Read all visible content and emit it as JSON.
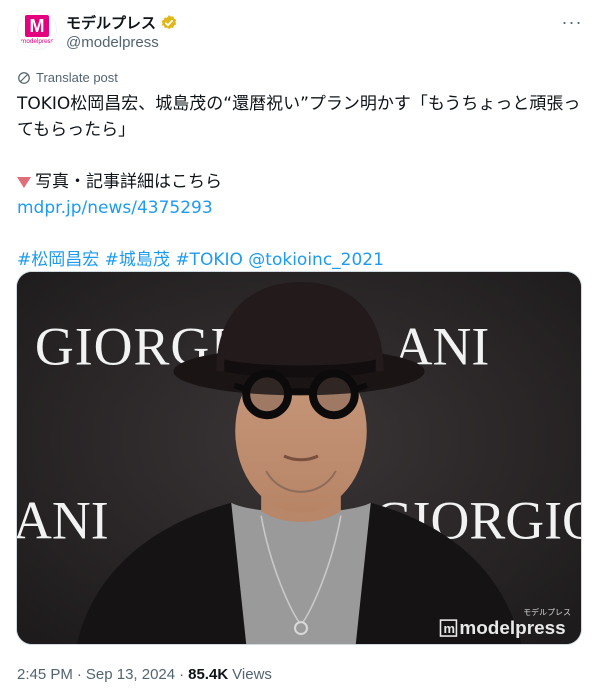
{
  "account": {
    "display_name": "モデルプレス",
    "handle": "@modelpress",
    "verified_badge_color": "#e2b719",
    "avatar_letter": "M",
    "avatar_sub": "modelpress",
    "brand_color": "#e4007f"
  },
  "more_icon": "more-horizontal-icon",
  "translate_label": "Translate post",
  "post": {
    "line1": "TOKIO松岡昌宏、城島茂の“還暦祝い”プラン明かす「もうちょっと頑張っ",
    "line2": "てもらったら」",
    "info_label": "写真・記事詳細はこちら",
    "link": "mdpr.jp/news/4375293",
    "hashtags": [
      "#松岡昌宏",
      "#城島茂",
      "#TOKIO",
      "@tokioinc_2021"
    ]
  },
  "media": {
    "backdrop_text_top": "GIORGIO",
    "backdrop_text_top_right": "ANI",
    "backdrop_text_bottom_left": "ANI",
    "backdrop_text_bottom_right": "GIORGIO",
    "watermark_small": "モデルプレス",
    "watermark_large": "modelpress"
  },
  "meta": {
    "time": "2:45 PM",
    "separator": "·",
    "date": "Sep 13, 2024",
    "views_count": "85.4K",
    "views_label": "Views"
  },
  "colors": {
    "link": "#1d9bf0",
    "text": "#0f1419",
    "secondary": "#536471"
  }
}
